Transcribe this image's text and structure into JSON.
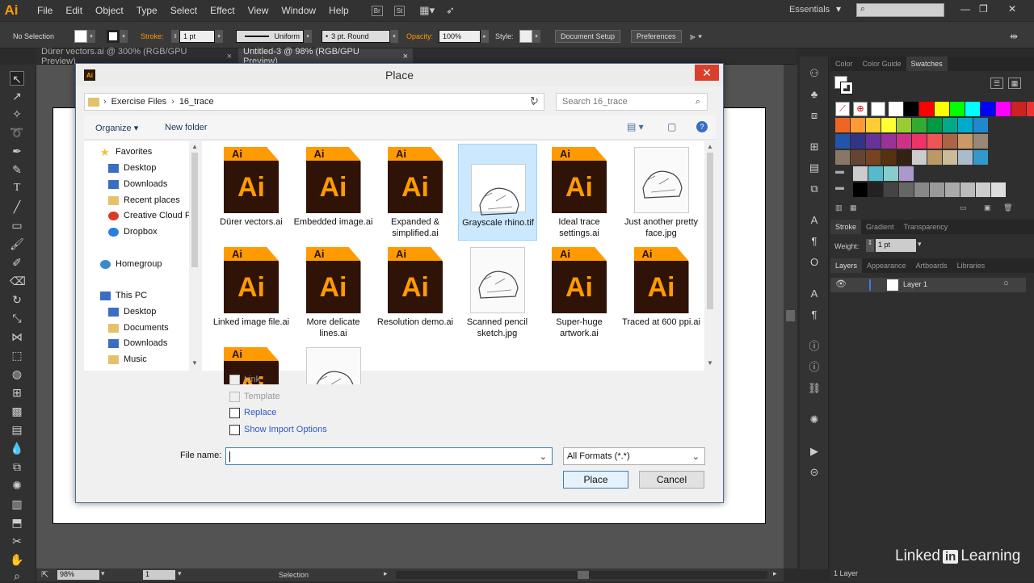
{
  "menubar": {
    "logo": "Ai",
    "items": [
      "File",
      "Edit",
      "Object",
      "Type",
      "Select",
      "Effect",
      "View",
      "Window",
      "Help"
    ],
    "br": "Br",
    "st": "St",
    "workspace": "Essentials"
  },
  "control": {
    "selection": "No Selection",
    "stroke_label": "Stroke:",
    "stroke_weight": "1 pt",
    "profile": "Uniform",
    "brush": "3 pt. Round",
    "opacity_label": "Opacity:",
    "opacity": "100%",
    "style_label": "Style:",
    "doc_setup": "Document Setup",
    "preferences": "Preferences"
  },
  "doc_tabs": [
    {
      "label": "Dürer vectors.ai @ 300% (RGB/GPU Preview)"
    },
    {
      "label": "Untitled-3 @ 98% (RGB/GPU Preview)"
    }
  ],
  "status": {
    "zoom": "98%",
    "page": "1",
    "tool": "Selection"
  },
  "panels": {
    "color_tabs": [
      "Color",
      "Color Guide",
      "Swatches"
    ],
    "stroke_tabs": [
      "Stroke",
      "Gradient",
      "Transparency"
    ],
    "weight_label": "Weight:",
    "weight": "1 pt",
    "layers_tabs": [
      "Layers",
      "Appearance",
      "Artboards",
      "Libraries"
    ],
    "layer_name": "Layer 1",
    "layer_count": "1 Layer"
  },
  "swatch_colors": {
    "row1": [
      "#ffffff",
      "#000000",
      "#ff0000",
      "#ffff00",
      "#00ff00",
      "#00ffff",
      "#0000ff",
      "#ff00ff",
      "#cc2222",
      "#ee3333"
    ],
    "row2": [
      "#ee6622",
      "#ff9933",
      "#ffcc33",
      "#ffff33",
      "#99cc33",
      "#33aa33",
      "#009944",
      "#00aa88",
      "#00aacc",
      "#2288cc"
    ],
    "row3": [
      "#2255aa",
      "#333388",
      "#663399",
      "#993399",
      "#cc3388",
      "#ee3366",
      "#ee5555",
      "#aa6644",
      "#cc9966",
      "#998877"
    ],
    "row4": [
      "#887766",
      "#664433",
      "#774422",
      "#553311",
      "#332211",
      "#cccccc",
      "#bb9966",
      "#ccbb99",
      "#aabbcc",
      "#3399cc"
    ],
    "row5": [
      "#cccccc",
      "#55bbcc",
      "#88cccc",
      "#aa99cc"
    ],
    "row6": [
      "#000000",
      "#222222",
      "#444444",
      "#666666",
      "#888888",
      "#999999",
      "#aaaaaa",
      "#bbbbbb",
      "#cccccc",
      "#dddddd"
    ]
  },
  "dialog": {
    "title": "Place",
    "breadcrumb": [
      "Exercise Files",
      "16_trace"
    ],
    "search_placeholder": "Search 16_trace",
    "organize": "Organize",
    "new_folder": "New folder",
    "nav": [
      {
        "label": "Favorites",
        "icon": "star-icon",
        "color": "#f2c12e"
      },
      {
        "label": "Desktop",
        "icon": "desktop-icon",
        "color": "#3a6ec4"
      },
      {
        "label": "Downloads",
        "icon": "downloads-icon",
        "color": "#3a6ec4"
      },
      {
        "label": "Recent places",
        "icon": "recent-icon",
        "color": "#e3c26b"
      },
      {
        "label": "Creative Cloud Fi",
        "icon": "creative-cloud-icon",
        "color": "#d83a2a"
      },
      {
        "label": "Dropbox",
        "icon": "dropbox-icon",
        "color": "#2a7de1"
      },
      {
        "label": "Homegroup",
        "icon": "homegroup-icon",
        "color": "#3a8ccc"
      },
      {
        "label": "This PC",
        "icon": "computer-icon",
        "color": "#3a6ec4"
      },
      {
        "label": "Desktop",
        "icon": "desktop-icon",
        "color": "#3a6ec4"
      },
      {
        "label": "Documents",
        "icon": "documents-icon",
        "color": "#e3c26b"
      },
      {
        "label": "Downloads",
        "icon": "downloads-icon",
        "color": "#3a6ec4"
      },
      {
        "label": "Music",
        "icon": "music-icon",
        "color": "#e3c26b"
      }
    ],
    "files": [
      {
        "name": "Dürer vectors.ai",
        "type": "ai"
      },
      {
        "name": "Embedded image.ai",
        "type": "ai"
      },
      {
        "name": "Expanded & simplified.ai",
        "type": "ai"
      },
      {
        "name": "Grayscale rhino.tif",
        "type": "image",
        "selected": true
      },
      {
        "name": "Ideal trace settings.ai",
        "type": "ai"
      },
      {
        "name": "Just another pretty face.jpg",
        "type": "image"
      },
      {
        "name": "Linked image file.ai",
        "type": "ai"
      },
      {
        "name": "More delicate lines.ai",
        "type": "ai"
      },
      {
        "name": "Resolution demo.ai",
        "type": "ai"
      },
      {
        "name": "Scanned pencil sketch.jpg",
        "type": "image"
      },
      {
        "name": "Super-huge artwork.ai",
        "type": "ai"
      },
      {
        "name": "Traced at 600 ppi.ai",
        "type": "ai"
      },
      {
        "name": "",
        "type": "ai"
      },
      {
        "name": "",
        "type": "image"
      }
    ],
    "options": [
      {
        "label": "Link",
        "enabled": false
      },
      {
        "label": "Template",
        "enabled": false
      },
      {
        "label": "Replace",
        "enabled": true
      },
      {
        "label": "Show Import Options",
        "enabled": true
      }
    ],
    "file_name_label": "File name:",
    "file_name_value": "",
    "format": "All Formats (*.*)",
    "place_button": "Place",
    "cancel_button": "Cancel"
  },
  "watermark": {
    "pre": "Linked",
    "mid": "in",
    "post": "Learning"
  }
}
